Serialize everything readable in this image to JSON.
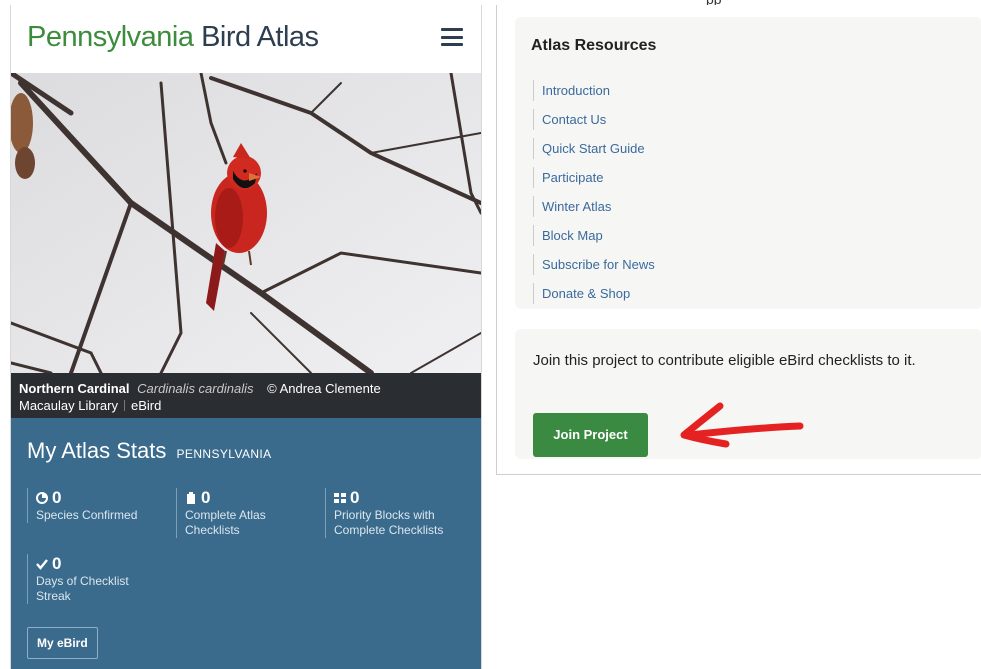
{
  "header": {
    "logo_part1": "Pennsylvania",
    "logo_part2": "Bird Atlas",
    "menu_icon": "hamburger-menu-icon"
  },
  "photo": {
    "common_name": "Northern Cardinal",
    "scientific_name": "Cardinalis cardinalis",
    "credit": "© Andrea Clemente",
    "library": "Macaulay Library",
    "source": "eBird"
  },
  "stats": {
    "title": "My Atlas Stats",
    "region": "PENNSYLVANIA",
    "items": [
      {
        "icon": "pie-chart-icon",
        "value": "0",
        "label": "Species Confirmed"
      },
      {
        "icon": "clipboard-icon",
        "value": "0",
        "label": "Complete Atlas Checklists"
      },
      {
        "icon": "grid-blocks-icon",
        "value": "0",
        "label": "Priority Blocks with Complete Checklists"
      },
      {
        "icon": "check-icon",
        "value": "0",
        "label": "Days of Checklist Streak"
      }
    ],
    "button_label": "My eBird"
  },
  "top_text": "pp",
  "resources": {
    "title": "Atlas Resources",
    "links": [
      "Introduction",
      "Contact Us",
      "Quick Start Guide",
      "Participate",
      "Winter Atlas",
      "Block Map",
      "Subscribe for News",
      "Donate & Shop"
    ]
  },
  "join": {
    "text": "Join this project to contribute eligible eBird checklists to it.",
    "button_label": "Join Project"
  },
  "colors": {
    "logo_green": "#3d8b3d",
    "logo_navy": "#2d3e50",
    "stats_bg": "#3a6b8c",
    "link_blue": "#3a6a9c",
    "join_green": "#3a8a42",
    "annotation_red": "#e52222"
  }
}
